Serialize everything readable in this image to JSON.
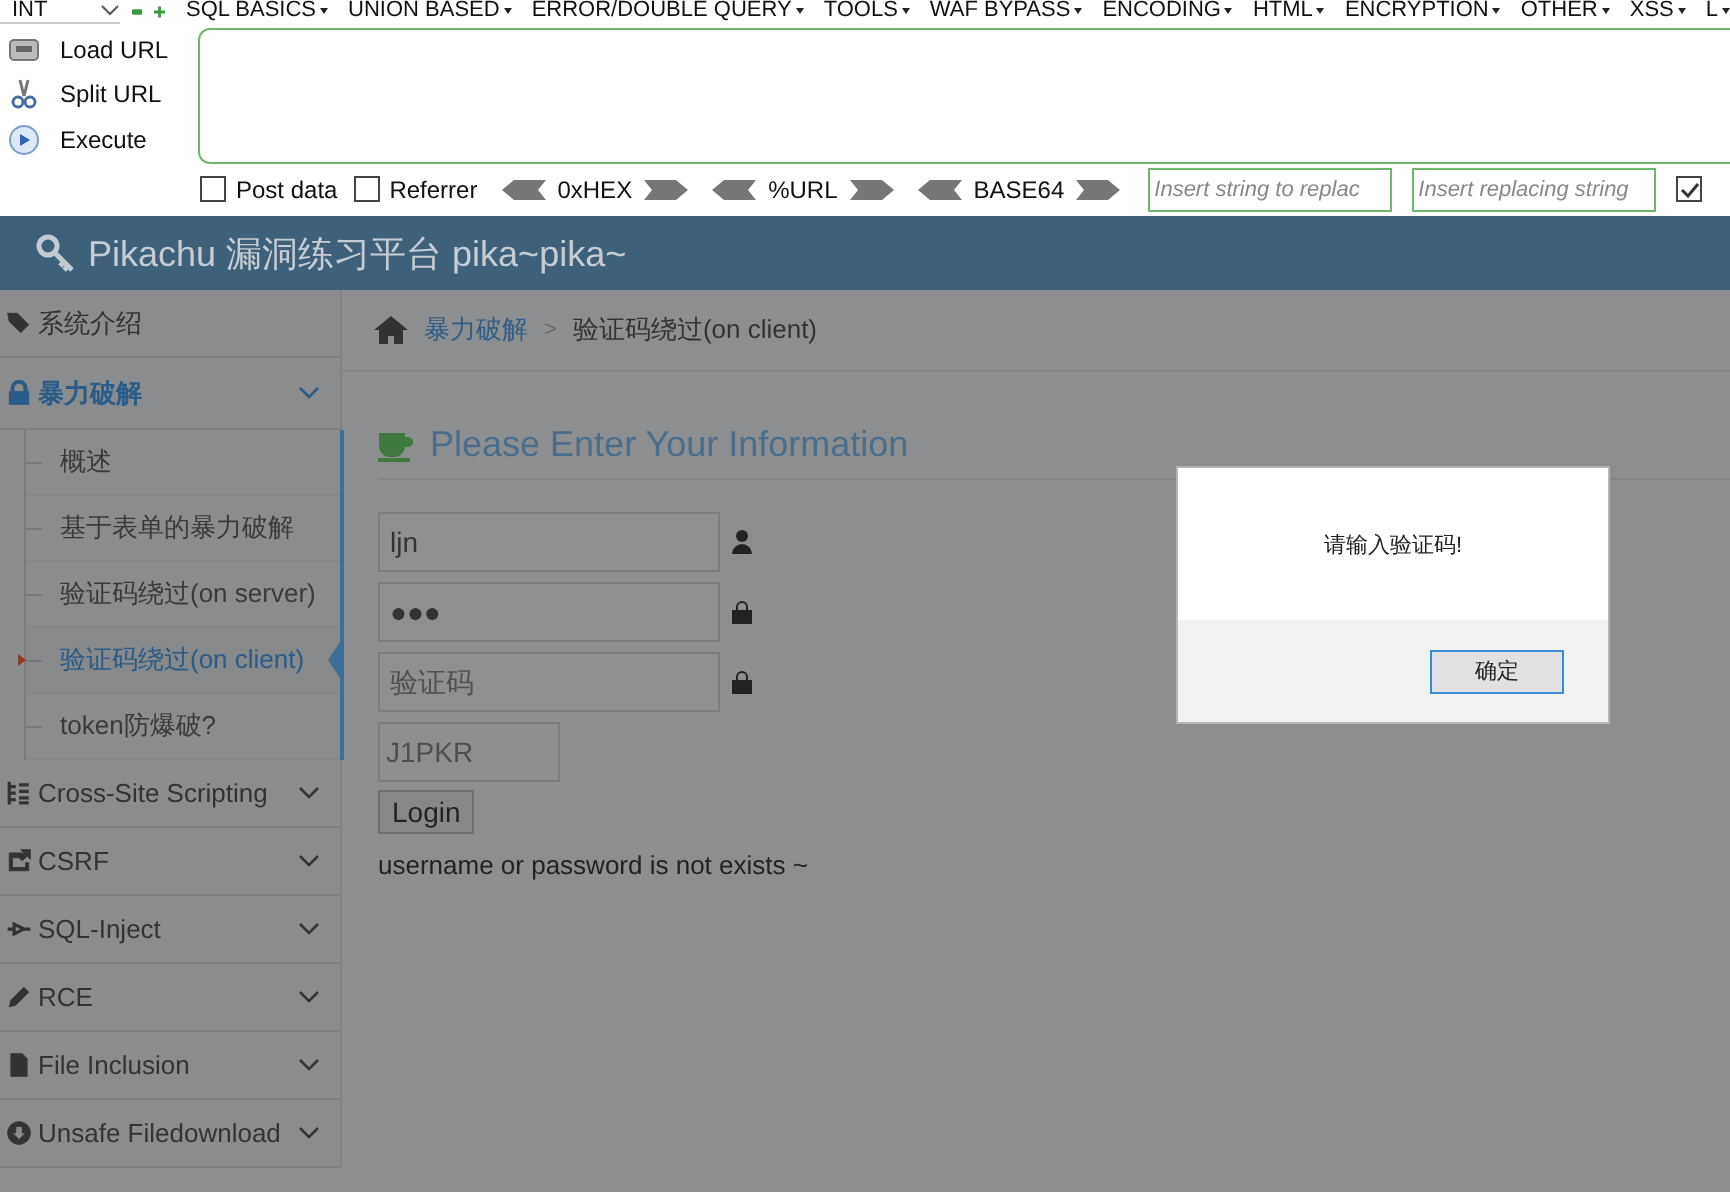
{
  "hackbar": {
    "url_type": "INT",
    "menus": [
      "SQL BASICS",
      "UNION BASED",
      "ERROR/DOUBLE QUERY",
      "TOOLS",
      "WAF BYPASS",
      "ENCODING",
      "HTML",
      "ENCRYPTION",
      "OTHER",
      "XSS",
      "L"
    ],
    "actions": [
      {
        "kind": "load",
        "label": "Load URL"
      },
      {
        "kind": "split",
        "label": "Split URL"
      },
      {
        "kind": "execute",
        "label": "Execute"
      }
    ],
    "options": [
      {
        "label": "Post data",
        "checked": false
      },
      {
        "label": "Referrer",
        "checked": false
      }
    ],
    "encoders": [
      "0xHEX",
      "%URL",
      "BASE64"
    ],
    "replace_from": {
      "placeholder": "Insert string to replac"
    },
    "replace_to": {
      "placeholder": "Insert replacing string"
    },
    "extra_checkbox": {
      "checked": true
    }
  },
  "header": {
    "title": "Pikachu 漏洞练习平台 pika~pika~"
  },
  "sidebar": {
    "items": [
      {
        "label": "系统介绍",
        "expanded": false,
        "has_toggle": false
      },
      {
        "label": "暴力破解",
        "expanded": true,
        "has_toggle": true,
        "children": [
          {
            "label": "概述",
            "selected": false
          },
          {
            "label": "基于表单的暴力破解",
            "selected": false
          },
          {
            "label": "验证码绕过(on server)",
            "selected": false
          },
          {
            "label": "验证码绕过(on client)",
            "selected": true
          },
          {
            "label": "token防爆破?",
            "selected": false
          }
        ]
      },
      {
        "label": "Cross-Site Scripting",
        "expanded": false,
        "has_toggle": true
      },
      {
        "label": "CSRF",
        "expanded": false,
        "has_toggle": true
      },
      {
        "label": "SQL-Inject",
        "expanded": false,
        "has_toggle": true
      },
      {
        "label": "RCE",
        "expanded": false,
        "has_toggle": true
      },
      {
        "label": "File Inclusion",
        "expanded": false,
        "has_toggle": true
      },
      {
        "label": "Unsafe Filedownload",
        "expanded": false,
        "has_toggle": true
      }
    ]
  },
  "breadcrumb": {
    "parent": "暴力破解",
    "separator": ">",
    "current": "验证码绕过(on client)"
  },
  "form": {
    "heading": "Please Enter Your Information",
    "username": {
      "value": "ljn"
    },
    "password": {
      "value": "●●●"
    },
    "captcha": {
      "placeholder": "验证码"
    },
    "captcha_code": "J1PKR",
    "button": "Login",
    "message": "username or password is not exists ~"
  },
  "dialog": {
    "message": "请输入验证码!",
    "button": "确定"
  }
}
